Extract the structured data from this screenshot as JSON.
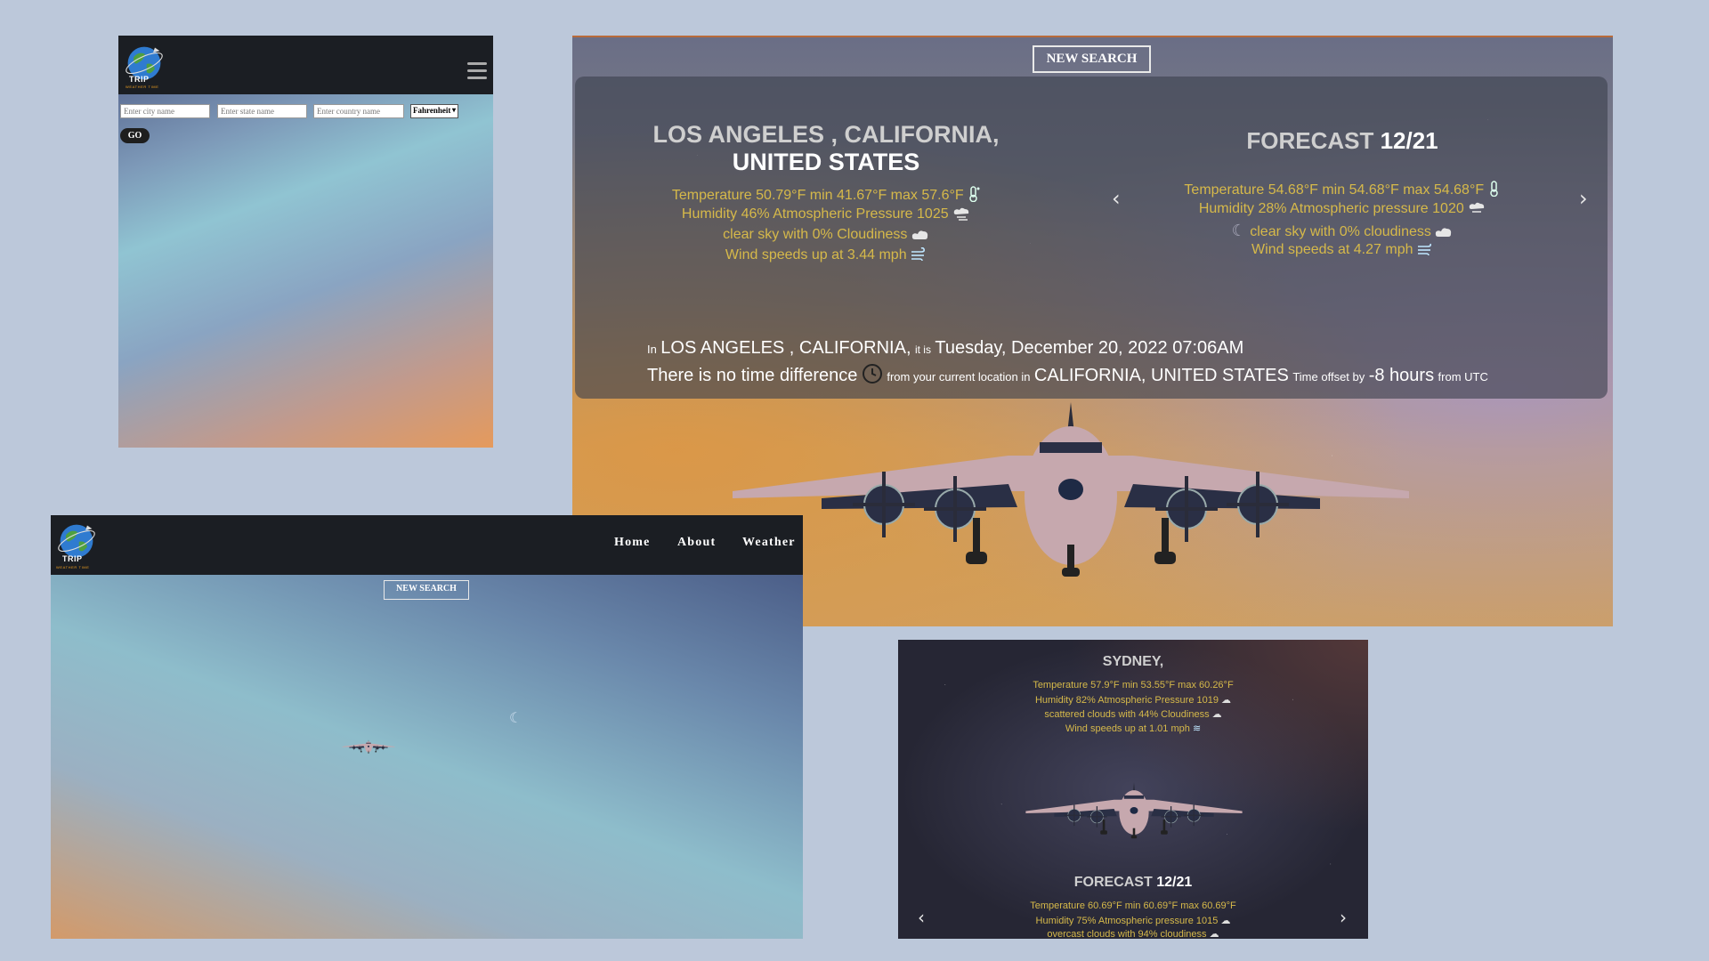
{
  "brand": {
    "logo_text": "TRIP",
    "logo_subtext": "WEATHER TIME"
  },
  "mobile_search": {
    "city_placeholder": "Enter city name",
    "state_placeholder": "Enter state name",
    "country_placeholder": "Enter country name",
    "unit_selected": "Fahrenheit",
    "go_label": "GO"
  },
  "main_view": {
    "new_search_label": "NEW SEARCH",
    "current": {
      "city_line": "LOS ANGELES , CALIFORNIA,",
      "country_line": "UNITED STATES",
      "temperature": "Temperature 50.79°F min 41.67°F max 57.6°F",
      "humidity": "Humidity 46% Atmospheric Pressure 1025",
      "sky": "clear sky with 0% Cloudiness",
      "wind": "Wind speeds up at 3.44 mph"
    },
    "forecast": {
      "label": "FORECAST",
      "date": "12/21",
      "temperature": "Temperature 54.68°F min 54.68°F max 54.68°F",
      "humidity": "Humidity 28% Atmospheric pressure 1020",
      "sky": "clear sky with 0% cloudiness",
      "wind": "Wind speeds at 4.27 mph"
    },
    "time_info": {
      "in_word": "In",
      "location": "LOS ANGELES , CALIFORNIA,",
      "it_is": "it is",
      "datetime": "Tuesday, December 20, 2022 07:06AM",
      "no_diff": "There is no time difference",
      "from_current": "from your current location in",
      "region": "CALIFORNIA, UNITED STATES",
      "offset_label": "Time offset by",
      "offset_value": "-8 hours",
      "from_utc": "from UTC"
    }
  },
  "desktop_nav": {
    "links": [
      "Home",
      "About",
      "Weather"
    ],
    "new_search_label": "NEW SEARCH"
  },
  "sydney": {
    "city": "SYDNEY,",
    "temperature": "Temperature 57.9°F min 53.55°F max 60.26°F",
    "humidity": "Humidity 82% Atmospheric Pressure 1019",
    "sky": "scattered clouds with 44% Cloudiness",
    "wind": "Wind speeds up at 1.01 mph",
    "forecast_label": "FORECAST",
    "forecast_date": "12/21",
    "f_temperature": "Temperature 60.69°F min 60.69°F max 60.69°F",
    "f_humidity": "Humidity 75% Atmospheric pressure 1015",
    "f_sky": "overcast clouds with 94% cloudiness"
  },
  "icons": [
    "thermometer-icon",
    "cloud-rain-icon",
    "cloud-icon",
    "wind-icon",
    "clock-icon",
    "moon-icon",
    "hamburger-icon",
    "chevron-left-icon",
    "chevron-right-icon",
    "airplane",
    "globe-logo"
  ],
  "colors": {
    "page_bg": "#bcc8da",
    "navbar_bg": "#1b1e23",
    "weather_text": "#d6b94a",
    "title_text": "#cfcfcf"
  }
}
